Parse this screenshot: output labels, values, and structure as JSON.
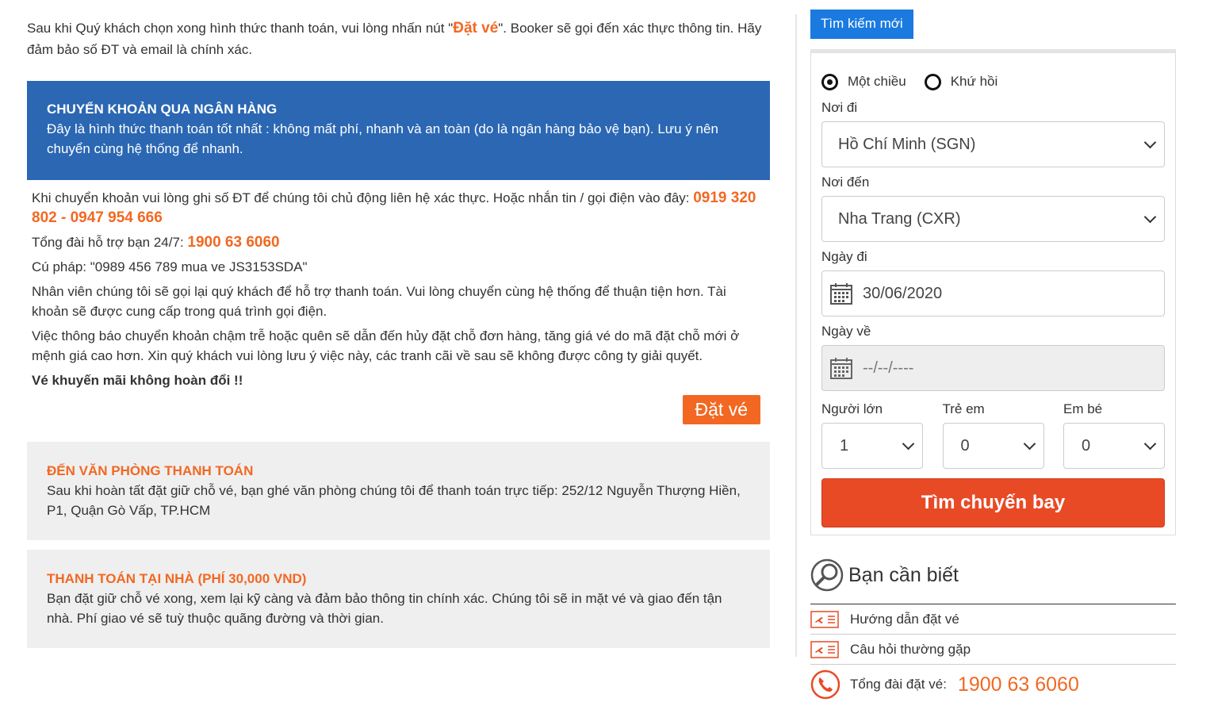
{
  "intro": {
    "part1": "Sau khi Quý khách chọn xong hình thức thanh toán, vui lòng nhấn nút \"",
    "highlight": "Đặt vé",
    "part2": "\". Booker sẽ gọi đến xác thực thông tin. Hãy đảm bảo số ĐT và email là chính xác."
  },
  "bank": {
    "title": "CHUYỂN KHOẢN QUA NGÂN HÀNG",
    "desc": "Đây là hình thức thanh toán tốt nhất : không mất phí, nhanh và an toàn (do là ngân hàng bảo vệ bạn). Lưu ý nên chuyển cùng hệ thống để nhanh.",
    "contact_text": "Khi chuyển khoản vui lòng ghi số ĐT để chúng tôi chủ động liên hệ xác thực. Hoặc nhắn tin / gọi điện vào đây: ",
    "contact_phones": "0919 320 802 - 0947 954 666",
    "hotline_text": "Tổng đài hỗ trợ bạn 24/7: ",
    "hotline_number": "1900 63 6060",
    "syntax": "Cú pháp: \"0989 456 789 mua ve JS3153SDA\"",
    "note1": "Nhân viên chúng tôi sẽ gọi lại quý khách để hỗ trợ thanh toán. Vui lòng chuyển cùng hệ thống để thuận tiện hơn. Tài khoản sẽ được cung cấp trong quá trình gọi điện.",
    "note2": "Việc thông báo chuyển khoản chậm trễ hoặc quên sẽ dẫn đến hủy đặt chỗ đơn hàng, tăng giá vé do mã đặt chỗ mới ở mệnh giá cao hơn. Xin quý khách vui lòng lưu ý việc này, các tranh cãi về sau sẽ không được công ty giải quyết.",
    "promo_note": "Vé khuyến mãi không hoàn đổi !!",
    "book_button": "Đặt vé"
  },
  "office": {
    "title": "ĐẾN VĂN PHÒNG THANH TOÁN",
    "desc": "Sau khi hoàn tất đặt giữ chỗ vé, bạn ghé văn phòng chúng tôi để thanh toán trực tiếp: 252/12 Nguyễn Thượng Hiền, P1, Quận Gò Vấp, TP.HCM"
  },
  "home": {
    "title": "THANH TOÁN TẠI NHÀ (PHÍ 30,000 VND)",
    "desc": "Bạn đặt giữ chỗ vé xong, xem lại kỹ càng và đảm bảo thông tin chính xác. Chúng tôi sẽ in mặt vé và giao đến tận nhà. Phí giao vé sẽ tuỳ thuộc quãng đường và thời gian."
  },
  "search": {
    "new_search_button": "Tìm kiếm mới",
    "one_way": "Một chiều",
    "round_trip": "Khứ hồi",
    "selected_trip": "one_way",
    "from_label": "Nơi đi",
    "from_value": "Hồ Chí Minh (SGN)",
    "to_label": "Nơi đến",
    "to_value": "Nha Trang (CXR)",
    "depart_label": "Ngày đi",
    "depart_value": "30/06/2020",
    "return_label": "Ngày về",
    "return_value": "--/--/----",
    "adults_label": "Người lớn",
    "adults_value": "1",
    "children_label": "Trẻ em",
    "children_value": "0",
    "infants_label": "Em bé",
    "infants_value": "0",
    "submit_button": "Tìm chuyến bay"
  },
  "info": {
    "title": "Bạn cần biết",
    "links": [
      "Hướng dẫn đặt vé",
      "Câu hỏi thường gặp"
    ],
    "hotline_label": "Tổng đài đặt vé:",
    "hotline_number": "1900 63 6060"
  },
  "colors": {
    "bank_blue": "#2b67b3",
    "accent_orange": "#f26822",
    "search_red": "#e84a26",
    "new_search_blue": "#1a7ae0"
  }
}
